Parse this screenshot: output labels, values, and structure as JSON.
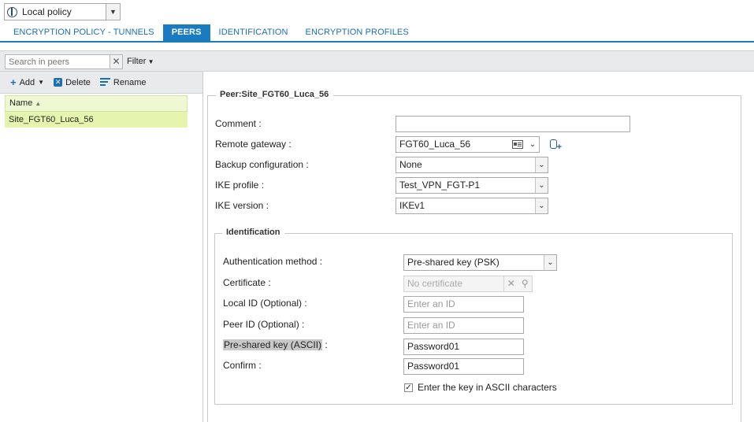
{
  "policy_select": {
    "label": "Local policy"
  },
  "tabs": [
    {
      "label": "ENCRYPTION POLICY - TUNNELS",
      "active": false
    },
    {
      "label": "PEERS",
      "active": true
    },
    {
      "label": "IDENTIFICATION",
      "active": false
    },
    {
      "label": "ENCRYPTION PROFILES",
      "active": false
    }
  ],
  "search": {
    "placeholder": "Search in peers",
    "clear_icon": "✕"
  },
  "filter_label": "Filter",
  "actions": {
    "add": "Add",
    "delete": "Delete",
    "rename": "Rename"
  },
  "grid": {
    "column": "Name",
    "rows": [
      "Site_FGT60_Luca_56"
    ]
  },
  "peer": {
    "legend": "Peer:Site_FGT60_Luca_56",
    "comment_label": "Comment :",
    "comment_value": "",
    "remote_gateway_label": "Remote gateway :",
    "remote_gateway_value": "FGT60_Luca_56",
    "backup_label": "Backup configuration :",
    "backup_value": "None",
    "ike_profile_label": "IKE profile :",
    "ike_profile_value": "Test_VPN_FGT-P1",
    "ike_version_label": "IKE version :",
    "ike_version_value": "IKEv1"
  },
  "identification": {
    "legend": "Identification",
    "auth_method_label": "Authentication method :",
    "auth_method_value": "Pre-shared key (PSK)",
    "certificate_label": "Certificate :",
    "certificate_placeholder": "No certificate",
    "local_id_label": "Local ID (Optional) :",
    "local_id_placeholder": "Enter an ID",
    "peer_id_label": "Peer ID (Optional) :",
    "peer_id_placeholder": "Enter an ID",
    "psk_label": "Pre-shared key (ASCII)",
    "psk_colon": " :",
    "psk_value": "Password01",
    "confirm_label": "Confirm :",
    "confirm_value": "Password01",
    "ascii_checkbox_label": "Enter the key in ASCII characters",
    "ascii_checked": true
  },
  "colors": {
    "accent": "#1a7bc0",
    "grid_selected": "#e6f5ae",
    "grid_header": "#eef8d2"
  }
}
